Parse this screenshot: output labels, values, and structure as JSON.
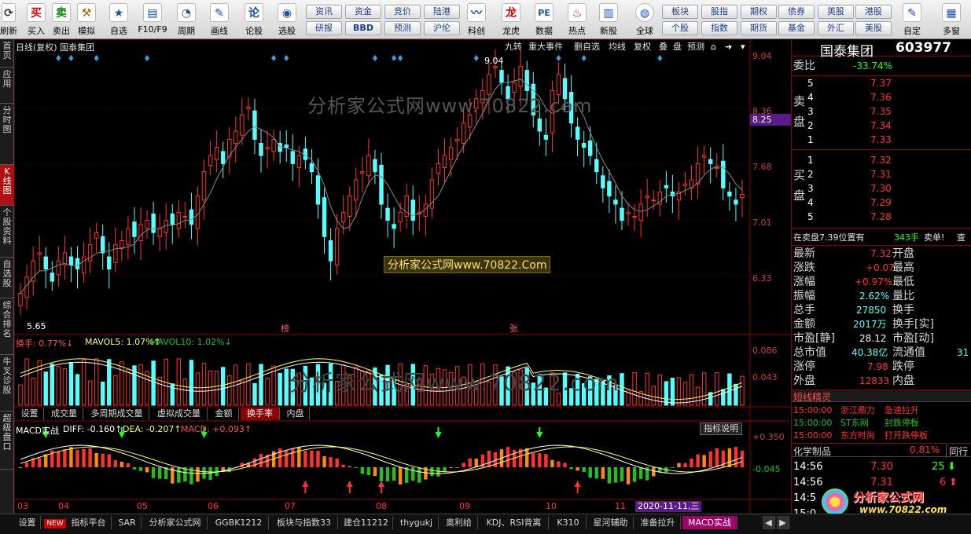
{
  "toolbar": {
    "items": [
      {
        "label": "刷新",
        "icon": "refresh-icon",
        "glyph": "⟳"
      },
      {
        "label": "买入",
        "icon": "buy-icon",
        "glyph": "买"
      },
      {
        "label": "卖出",
        "icon": "sell-icon",
        "glyph": "卖"
      },
      {
        "label": "模拟",
        "icon": "hammer-icon",
        "glyph": "⚒"
      },
      {
        "label": "自选",
        "icon": "star-icon",
        "glyph": "★"
      },
      {
        "label": "F10/F9",
        "icon": "f10-icon",
        "glyph": "▤"
      },
      {
        "label": "周期",
        "icon": "clock-icon",
        "glyph": "◔"
      },
      {
        "label": "画线",
        "icon": "pencil-icon",
        "glyph": "✎"
      },
      {
        "label": "论股",
        "icon": "discuss-icon",
        "glyph": "论"
      },
      {
        "label": "选股",
        "icon": "chart-select-icon",
        "glyph": "◉"
      }
    ],
    "grid": [
      {
        "label": "资讯"
      },
      {
        "label": "资金"
      },
      {
        "label": "竞价"
      },
      {
        "label": "陆港"
      },
      {
        "label": "研报"
      },
      {
        "label": "BBD"
      },
      {
        "label": "预测"
      },
      {
        "label": "沪伦"
      }
    ],
    "items2": [
      {
        "label": "科创",
        "icon": "kechuang-icon",
        "glyph": "〰"
      },
      {
        "label": "龙虎",
        "icon": "dragon-icon",
        "glyph": "龙"
      },
      {
        "label": "数据",
        "icon": "pe-icon",
        "glyph": "PE"
      },
      {
        "label": "热点",
        "icon": "fire-icon",
        "glyph": "♨"
      },
      {
        "label": "新股",
        "icon": "ipo-icon",
        "glyph": "▥"
      },
      {
        "label": "全球",
        "icon": "globe-icon",
        "glyph": "◍"
      }
    ],
    "grid2": [
      {
        "label": "板块"
      },
      {
        "label": "股指"
      },
      {
        "label": "期权"
      },
      {
        "label": "债券"
      },
      {
        "label": "英股"
      },
      {
        "label": "港股"
      },
      {
        "label": "个股"
      },
      {
        "label": "指数"
      },
      {
        "label": "期货"
      },
      {
        "label": "基金"
      },
      {
        "label": "外汇"
      },
      {
        "label": "美股"
      }
    ],
    "items3": [
      {
        "label": "自定",
        "icon": "customize-icon",
        "glyph": "✎"
      },
      {
        "label": "多窗",
        "icon": "multiwindow-icon",
        "glyph": "▦"
      }
    ]
  },
  "left_tabs": [
    {
      "label": "首页",
      "active": false
    },
    {
      "label": "应用",
      "active": false
    },
    {
      "label": "分时图",
      "active": false
    },
    {
      "label": "K线图",
      "active": true
    },
    {
      "label": "个股资料",
      "active": false
    },
    {
      "label": "自选股",
      "active": false
    },
    {
      "label": "综合排名",
      "active": false
    },
    {
      "label": "牛叉诊股",
      "active": false
    },
    {
      "label": "超级盘口",
      "active": false
    }
  ],
  "chart": {
    "header_title": "日线(复权) 国泰集团",
    "controls": [
      "九转",
      "重大事件",
      "删自选",
      "均线",
      "复权",
      "叠",
      "盘",
      "预测"
    ],
    "watermark": "分析家公式网www.70822.com",
    "badge": "分析家公式网www.70822.Com",
    "high_label": "9.04",
    "low_label": "5.65",
    "price_axis": [
      "9.04",
      "8.36",
      "7.68",
      "7.01",
      "6.33"
    ],
    "current_price_tag": "8.25",
    "event_marks": [
      "榜",
      "张"
    ],
    "volume_header": {
      "a": "换手: 0.77%↓",
      "b": "MAVOL5: 1.07%↑",
      "c": "MAVOL10: 1.02%↓"
    },
    "volume_axis": [
      "0.086",
      "0.043"
    ],
    "sub_tabs": [
      {
        "label": "设置",
        "active": false
      },
      {
        "label": "成交量",
        "active": false
      },
      {
        "label": "多周期成交量",
        "active": false
      },
      {
        "label": "虚拟成交量",
        "active": false
      },
      {
        "label": "金额",
        "active": false
      },
      {
        "label": "换手率",
        "active": true
      },
      {
        "label": "内盘",
        "active": false
      }
    ],
    "macd_header": {
      "a": "MACD实战",
      "b": "DIFF: -0.160↑",
      "c": "DEA: -0.207↑",
      "d": "MACD: +0.093↑"
    },
    "indicator_button": "指标说明",
    "macd_axis": [
      "+0.350",
      "-0.045"
    ],
    "months": [
      "03",
      "04",
      "05",
      "06",
      "07",
      "08",
      "09",
      "10",
      "11"
    ],
    "date_tag": "2020-11-11,三",
    "colors": {
      "up": "#ff3232",
      "down": "#54ffff",
      "diamond": "#3aa0e0",
      "ma5": "#ffffff",
      "ma10": "#ffff60",
      "green": "#20c020",
      "purple": "#5a1a8a"
    }
  },
  "chart_data": {
    "type": "candlestick",
    "title": "日线(复权) 国泰集团",
    "ylim": [
      5.65,
      9.04
    ],
    "candles_close": [
      6.1,
      6.3,
      6.5,
      6.6,
      6.4,
      6.25,
      6.5,
      6.6,
      6.45,
      6.4,
      6.55,
      6.7,
      6.85,
      6.6,
      6.4,
      6.7,
      6.75,
      6.9,
      6.8,
      6.95,
      7.0,
      6.85,
      6.9,
      7.0,
      6.95,
      7.1,
      7.05,
      6.95,
      7.3,
      7.6,
      7.8,
      7.9,
      7.7,
      8.0,
      8.1,
      8.3,
      8.4,
      8.0,
      7.8,
      7.9,
      8.0,
      7.85,
      7.9,
      7.7,
      7.8,
      7.75,
      7.6,
      7.2,
      6.8,
      6.5,
      6.9,
      7.1,
      7.3,
      7.5,
      7.6,
      7.8,
      7.6,
      7.2,
      7.0,
      6.9,
      7.1,
      7.3,
      7.0,
      7.1,
      7.2,
      7.5,
      7.7,
      7.8,
      7.9,
      8.0,
      8.2,
      8.3,
      8.5,
      8.6,
      8.8,
      8.9,
      8.7,
      8.5,
      8.7,
      8.9,
      8.6,
      8.3,
      8.1,
      8.0,
      8.6,
      8.8,
      8.5,
      8.2,
      8.0,
      7.9,
      7.8,
      7.6,
      7.4,
      7.3,
      7.2,
      7.0,
      7.1,
      7.05,
      7.2,
      7.3,
      7.25,
      7.35,
      7.4,
      7.3,
      7.35,
      7.45,
      7.5,
      7.7,
      7.8,
      7.7,
      7.65,
      7.4,
      7.3,
      7.2,
      7.32
    ]
  },
  "quote": {
    "name": "国泰集团",
    "code": "603977",
    "weibi_label": "委比",
    "weibi_value": "-33.74%",
    "sell_label": "卖盘",
    "buy_label": "买盘",
    "sell": [
      {
        "lvl": "5",
        "price": "7.37"
      },
      {
        "lvl": "4",
        "price": "7.36"
      },
      {
        "lvl": "3",
        "price": "7.35"
      },
      {
        "lvl": "2",
        "price": "7.34"
      },
      {
        "lvl": "1",
        "price": "7.33"
      }
    ],
    "buy": [
      {
        "lvl": "1",
        "price": "7.32"
      },
      {
        "lvl": "2",
        "price": "7.31"
      },
      {
        "lvl": "3",
        "price": "7.30"
      },
      {
        "lvl": "4",
        "price": "7.29"
      },
      {
        "lvl": "5",
        "price": "7.28"
      }
    ],
    "alert": {
      "a": "在卖盘7.39位置有",
      "b": "343手",
      "c": "卖单!",
      "d": "查"
    },
    "stats": [
      {
        "l1": "最新",
        "v1": "7.32",
        "l2": "开盘"
      },
      {
        "l1": "涨跌",
        "v1": "+0.07",
        "l2": "最高"
      },
      {
        "l1": "涨幅",
        "v1": "+0.97%",
        "l2": "最低"
      },
      {
        "l1": "振幅",
        "v1": "2.62%",
        "l2": "量比"
      },
      {
        "l1": "总手",
        "v1": "27850",
        "l2": "换手"
      },
      {
        "l1": "金额",
        "v1": "2017万",
        "l2": "换手[实]"
      },
      {
        "l1": "市盈[静]",
        "v1": "28.12",
        "l2": "市盈[动]"
      },
      {
        "l1": "总市值",
        "v1": "40.38亿",
        "l2": "流通值"
      },
      {
        "l1": "涨停",
        "v1": "7.98",
        "l2": "跌停"
      },
      {
        "l1": "外盘",
        "v1": "12833",
        "l2": "内盘"
      }
    ],
    "liutong_extra": "31",
    "jingling_title": "短线精灵",
    "jingling": [
      {
        "t": "15:00:00",
        "n": "浙江鼎力",
        "e": "急速拉升"
      },
      {
        "t": "15:00:00",
        "n": "ST东网",
        "e": "封跌停板"
      },
      {
        "t": "15:00:00",
        "n": "东方时尚",
        "e": "打开跌停板"
      }
    ],
    "sector": {
      "name": "化学制品",
      "pct": "0.81%",
      "tab": "同行"
    },
    "ticks": [
      {
        "t": "14:56",
        "p": "7.30",
        "v": "25"
      },
      {
        "t": "14:56",
        "p": "7.31",
        "v": "6"
      },
      {
        "t": "14:5",
        "p": "",
        "v": ""
      },
      {
        "t": "15:0",
        "p": "",
        "v": ""
      }
    ],
    "logo": {
      "a": "分析家公式网",
      "b": "www.70822.com"
    }
  },
  "bottom_tabs": [
    {
      "label": "设置",
      "active": false
    },
    {
      "label": "NEW",
      "active": false
    },
    {
      "label": "指标平台",
      "active": false
    },
    {
      "label": "SAR",
      "active": false
    },
    {
      "label": "分析家公式网",
      "active": false
    },
    {
      "label": "GGBK1212",
      "active": false
    },
    {
      "label": "板块与指数33",
      "active": false
    },
    {
      "label": "建仓11212",
      "active": false
    },
    {
      "label": "thygukj",
      "active": false
    },
    {
      "label": "奥利给",
      "active": false
    },
    {
      "label": "KDJ、RSI背离",
      "active": false
    },
    {
      "label": "K310",
      "active": false
    },
    {
      "label": "星河辅助",
      "active": false
    },
    {
      "label": "准备拉升",
      "active": false
    },
    {
      "label": "MACD实战",
      "active": true
    }
  ]
}
